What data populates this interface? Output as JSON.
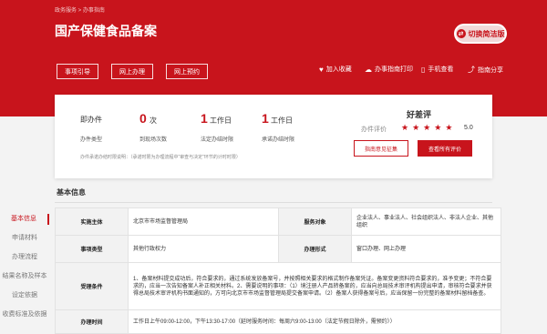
{
  "banner": {
    "breadcrumb": "政务服务  >  办事指南",
    "title": "国产保健食品备案",
    "switch_label": "切换简洁版",
    "actions": [
      "事项引导",
      "网上办理",
      "网上预约"
    ],
    "tools": [
      {
        "icon": "heart-icon",
        "label": "加入收藏"
      },
      {
        "icon": "cloud-icon",
        "label": "办事指南打印"
      },
      {
        "icon": "phone-icon",
        "label": "手机查看"
      },
      {
        "icon": "share-icon",
        "label": "指南分享"
      }
    ]
  },
  "metrics": {
    "metric1": {
      "label": "即办件",
      "value": "0",
      "unit": "次",
      "sub": "办件类型",
      "sub2": "到现场次数"
    },
    "metric2": {
      "value": "1",
      "unit": "工作日",
      "sub": "法定办结时限"
    },
    "metric3": {
      "value": "1",
      "unit": "工作日",
      "sub": "承诺办结时限"
    },
    "note": "办件承诺办结时限说明：（承诺时限为办理流程中“审查与决定”环节的计时时限）"
  },
  "evaluation": {
    "title": "好差评",
    "label": "办件评价",
    "stars": 5,
    "score": "5.0",
    "btn_advice": "指南意见征集",
    "btn_all": "查看所有评价"
  },
  "section_title": "基本信息",
  "sidebar": [
    "基本信息",
    "申请材料",
    "办理流程",
    "结果名称及样本",
    "设定依据",
    "收费标准及依据"
  ],
  "table": {
    "row1": {
      "k1": "实施主体",
      "v1": "北京市市场监督管理局",
      "k2": "服务对象",
      "v2": "企业法人、事业法人、社会组织法人、非法人企业、其他组织"
    },
    "row2": {
      "k1": "事项类型",
      "v1": "其他行政权力",
      "k2": "办理形式",
      "v2": "窗口办理、网上办理"
    },
    "row3": {
      "k": "受理条件",
      "v": "1、备案材料提交成功后，符合要求的，通过系统发放备案号，并按照相关要求的格式制作备案凭证。备案变更资料符合要求的，准予变更；不符合要求的，应当一次告知备案人补正相关材料。2、需要说明的事项：（1）境注册人产品转备案的，应当向总局技术审评机构提出申请，审核符合要求并获得总局技术审评机构书面通知的，方可向北京市市场监督管理局提交备案申请。（2）备案人获得备案号后，应当保留一份完整的备案材料留档备查。"
    },
    "row4": {
      "k": "办理时间",
      "v": "工作日上午09:00-12:00，下午13:30-17:00（延时服务时间：每周六9:00-13:00（法定节假日除外，需预约））"
    }
  },
  "colors": {
    "brand": "#c8141c",
    "page_bg": "#f3f3f3"
  }
}
